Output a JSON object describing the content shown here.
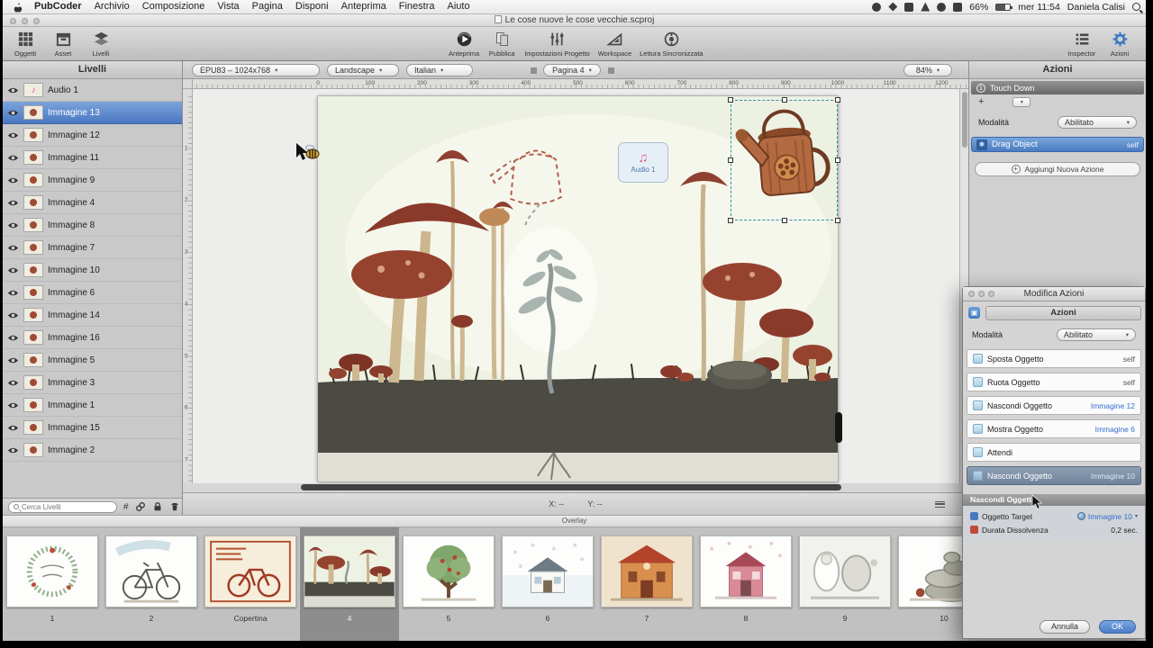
{
  "colors": {
    "accent_blue": "#4a7cc2",
    "selection_teal": "#2e8fa3",
    "link_blue": "#2f6fd0",
    "selected_row": "#70839a"
  },
  "menubar": {
    "items": [
      "PubCoder",
      "Archivio",
      "Composizione",
      "Vista",
      "Pagina",
      "Disponi",
      "Anteprima",
      "Finestra",
      "Aiuto"
    ],
    "status": {
      "battery": "66%",
      "clock": "mer 11:54",
      "user": "Daniela Calisi"
    },
    "status_icons": [
      "camera",
      "sync",
      "display",
      "bluetooth",
      "wifi",
      "volume"
    ]
  },
  "window": {
    "title": "Le cose nuove le cose vecchie.scproj"
  },
  "toolbar": {
    "left": [
      {
        "id": "oggetti",
        "label": "Oggetti"
      },
      {
        "id": "asset",
        "label": "Asset"
      },
      {
        "id": "livelli",
        "label": "Livelli"
      }
    ],
    "center": [
      {
        "id": "anteprima",
        "label": "Anteprima"
      },
      {
        "id": "pubblica",
        "label": "Pubblica"
      },
      {
        "id": "impostazioni",
        "label": "Impostazioni Progetto"
      },
      {
        "id": "workspace",
        "label": "Workspace"
      },
      {
        "id": "lettura",
        "label": "Lettura Sincronizzata"
      }
    ],
    "right": [
      {
        "id": "inspector",
        "label": "Inspector"
      },
      {
        "id": "azioni",
        "label": "Azioni"
      }
    ]
  },
  "layers": {
    "title": "Livelli",
    "items": [
      {
        "label": "Audio 1",
        "type": "audio",
        "selected": false
      },
      {
        "label": "Immagine 13",
        "type": "image",
        "selected": true
      },
      {
        "label": "Immagine 12",
        "type": "image",
        "selected": false
      },
      {
        "label": "Immagine 11",
        "type": "image",
        "selected": false
      },
      {
        "label": "Immagine 9",
        "type": "image",
        "selected": false
      },
      {
        "label": "Immagine 4",
        "type": "image",
        "selected": false
      },
      {
        "label": "Immagine 8",
        "type": "image",
        "selected": false
      },
      {
        "label": "Immagine 7",
        "type": "image",
        "selected": false
      },
      {
        "label": "Immagine 10",
        "type": "image",
        "selected": false
      },
      {
        "label": "Immagine 6",
        "type": "image",
        "selected": false
      },
      {
        "label": "Immagine 14",
        "type": "image",
        "selected": false
      },
      {
        "label": "Immagine 16",
        "type": "image",
        "selected": false
      },
      {
        "label": "Immagine 5",
        "type": "image",
        "selected": false
      },
      {
        "label": "Immagine 3",
        "type": "image",
        "selected": false
      },
      {
        "label": "Immagine 1",
        "type": "image",
        "selected": false
      },
      {
        "label": "Immagine 15",
        "type": "image",
        "selected": false
      },
      {
        "label": "Immagine 2",
        "type": "image",
        "selected": false
      }
    ],
    "footer": {
      "search_placeholder": "Cerca Livelli",
      "hash": "#"
    }
  },
  "canvasbar": {
    "format": "EPU83 – 1024x768",
    "orientation": "Landscape",
    "language": "Italian",
    "page": "Pagina 4",
    "zoom": "84%",
    "caret": "▾"
  },
  "rulers": {
    "top": [
      "0",
      "100",
      "200",
      "300",
      "400",
      "500",
      "600",
      "700",
      "800",
      "900",
      "1000",
      "1100",
      "1200"
    ],
    "left": [
      "1",
      "2",
      "3",
      "4",
      "5",
      "6",
      "7"
    ]
  },
  "canvas": {
    "audio_badge": "Audio 1",
    "coords_x": "X: --",
    "coords_y": "Y: --"
  },
  "overlay": {
    "label": "Overlay"
  },
  "filmstrip": {
    "pages": [
      {
        "label": "1",
        "art": "wreath",
        "selected": false
      },
      {
        "label": "2",
        "art": "bicycle",
        "selected": false
      },
      {
        "label": "Copertina",
        "art": "bicycle-red",
        "selected": false
      },
      {
        "label": "4",
        "art": "mushrooms",
        "selected": true
      },
      {
        "label": "5",
        "art": "tree",
        "selected": false
      },
      {
        "label": "6",
        "art": "house-snow",
        "selected": false
      },
      {
        "label": "7",
        "art": "castle",
        "selected": false
      },
      {
        "label": "8",
        "art": "pink-house",
        "selected": false
      },
      {
        "label": "9",
        "art": "figures",
        "selected": false
      },
      {
        "label": "10",
        "art": "rocks",
        "selected": false
      }
    ]
  },
  "actions_panel": {
    "title": "Azioni",
    "event_number": "1",
    "event_label": "Touch Down",
    "plus": "+",
    "caret": "▾",
    "modalita_label": "Modalità",
    "modalita_value": "Abilitato",
    "drag": {
      "label": "Drag Object",
      "target": "self"
    },
    "add_plus": "+",
    "add_label": "Aggiungi Nuova Azione"
  },
  "modifica": {
    "title": "Modifica Azioni",
    "header": "Azioni",
    "modalita_label": "Modalità",
    "modalita_value": "Abilitato",
    "caret": "▾",
    "actions": [
      {
        "label": "Sposta Oggetto",
        "target": "self",
        "selected": false
      },
      {
        "label": "Ruota Oggetto",
        "target": "self",
        "selected": false
      },
      {
        "label": "Nascondi Oggetto",
        "target": "Immagine 12",
        "selected": false
      },
      {
        "label": "Mostra Oggetto",
        "target": "Immagine 6",
        "selected": false
      },
      {
        "label": "Attendi",
        "target": "",
        "selected": false
      },
      {
        "label": "Nascondi Oggetto",
        "target": "Immagine 10",
        "selected": true
      }
    ],
    "section_header": "Nascondi Oggetto",
    "detail": [
      {
        "label": "Oggetto Target",
        "value": "Immagine 10",
        "icon": "blue",
        "link": true
      },
      {
        "label": "Durata Dissolvenza",
        "value": "0,2 sec.",
        "icon": "red",
        "link": false
      }
    ],
    "buttons": {
      "cancel": "Annulla",
      "ok": "OK"
    }
  }
}
